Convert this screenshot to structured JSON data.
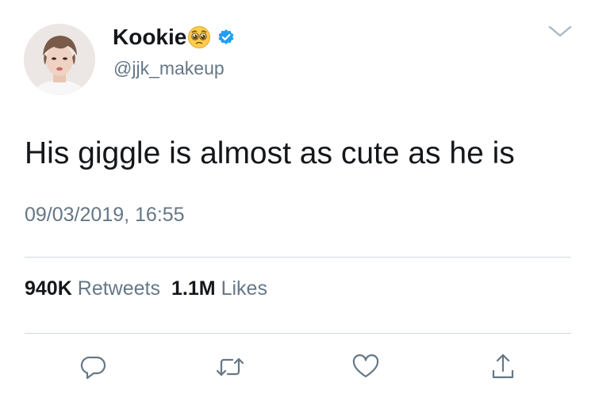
{
  "author": {
    "display_name": "Kookie",
    "handle": "@jjk_makeup",
    "verified": true,
    "emoji": "pleading-face"
  },
  "tweet": {
    "text": "His giggle is almost as cute as he is",
    "timestamp": "09/03/2019, 16:55"
  },
  "stats": {
    "retweets_count": "940K",
    "retweets_label": "Retweets",
    "likes_count": "1.1M",
    "likes_label": "Likes"
  },
  "icons": {
    "reply": "reply-icon",
    "retweet": "retweet-icon",
    "like": "heart-icon",
    "share": "share-icon",
    "menu": "chevron-down-icon"
  },
  "colors": {
    "text": "#14171a",
    "secondary": "#657786",
    "verified": "#1da1f2",
    "divider": "#cfd9de"
  }
}
